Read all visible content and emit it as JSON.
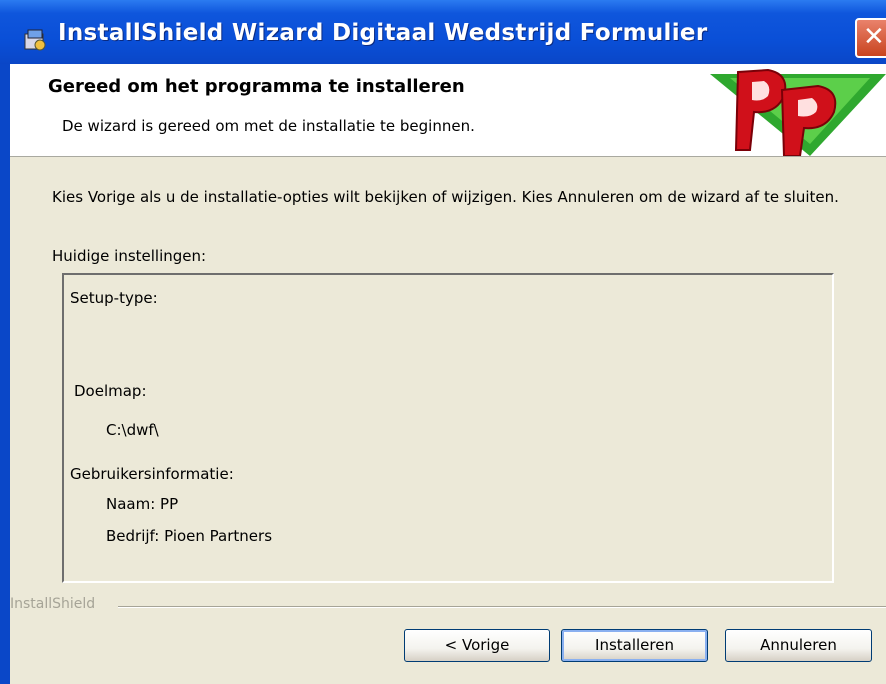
{
  "window": {
    "title": "InstallShield Wizard Digitaal Wedstrijd Formulier",
    "close_glyph": "✕"
  },
  "header": {
    "title": "Gereed om het programma te installeren",
    "subtitle": "De wizard is gereed om met de installatie te beginnen.",
    "logo_icon": "pp-logo-icon"
  },
  "content": {
    "intro": "Kies Vorige als u de installatie-opties wilt bekijken of wijzigen. Kies Annuleren om de wizard af te sluiten.",
    "current_settings_label": "Huidige instellingen:",
    "settings": {
      "setup_type_label": "Setup-type:",
      "destination_label": "Doelmap:",
      "destination_value": "C:\\dwf\\",
      "user_info_label": "Gebruikersinformatie:",
      "name_line": "Naam: PP",
      "company_line": "Bedrijf: Pioen Partners"
    }
  },
  "footer": {
    "brand": "InstallShield",
    "buttons": {
      "back": "< Vorige",
      "install": "Installeren",
      "cancel": "Annuleren"
    }
  },
  "colors": {
    "titlebar": "#0a4fd7",
    "dialog_bg": "#ece9d8",
    "close_red": "#c9441f",
    "logo_green": "#2fa82f",
    "logo_red": "#d0101a"
  }
}
